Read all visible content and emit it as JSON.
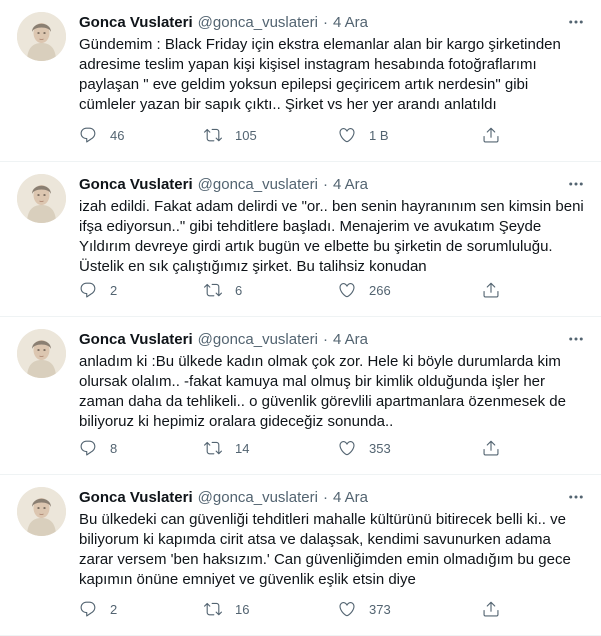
{
  "tweets": [
    {
      "name": "Gonca Vuslateri",
      "handle": "@gonca_vuslateri",
      "time": "4 Ara",
      "text": "Gündemim : Black Friday için ekstra elemanlar alan bir kargo şirketinden\nadresime teslim yapan kişi kişisel instagram hesabında fotoğraflarımı\npaylaşan \" eve geldim yoksun epilepsi geçiricem artık nerdesin\" gibi\ncümleler yazan bir sapık çıktı.. Şirket vs her yer arandı anlatıldı",
      "replies": "46",
      "retweets": "105",
      "likes": "1 B"
    },
    {
      "name": "Gonca Vuslateri",
      "handle": "@gonca_vuslateri",
      "time": "4 Ara",
      "text": "izah edildi. Fakat adam delirdi ve \"or.. ben senin hayranınım sen kimsin beni\nifşa ediyorsun..\" gibi tehditlere başladı. Menajerim ve avukatım Şeyde\nYıldırım devreye girdi artık bugün ve elbette bu şirketin de sorumluluğu.\nÜstelik en sık çalıştığımız şirket. Bu talihsiz konudan",
      "replies": "2",
      "retweets": "6",
      "likes": "266"
    },
    {
      "name": "Gonca Vuslateri",
      "handle": "@gonca_vuslateri",
      "time": "4 Ara",
      "text": "anladım ki :Bu ülkede kadın olmak çok zor. Hele ki böyle durumlarda kim\nolursak olalım.. -fakat kamuya mal olmuş bir kimlik olduğunda işler her\nzaman daha da tehlikeli.. o güvenlik görevlili apartmanlara özenmesek de\nbiliyoruz ki hepimiz oralara gideceğiz sonunda..",
      "replies": "8",
      "retweets": "14",
      "likes": "353"
    },
    {
      "name": "Gonca Vuslateri",
      "handle": "@gonca_vuslateri",
      "time": "4 Ara",
      "text": "Bu ülkedeki can güvenliği tehditleri mahalle kültürünü bitirecek belli ki..  ve\nbiliyorum ki kapımda cirit atsa ve dalaşsak, kendimi savunurken adama\nzarar versem 'ben haksızım.'  Can güvenliğimden emin olmadığım bu gece\nkapımın önüne emniyet ve güvenlik eşlik etsin diye",
      "replies": "2",
      "retweets": "16",
      "likes": "373"
    }
  ],
  "icons": {
    "more": "more-icon",
    "reply": "reply-icon",
    "retweet": "retweet-icon",
    "like": "like-icon",
    "share": "share-icon"
  },
  "colors": {
    "text": "#0f1419",
    "secondary": "#536471",
    "divider": "#eff3f4"
  }
}
